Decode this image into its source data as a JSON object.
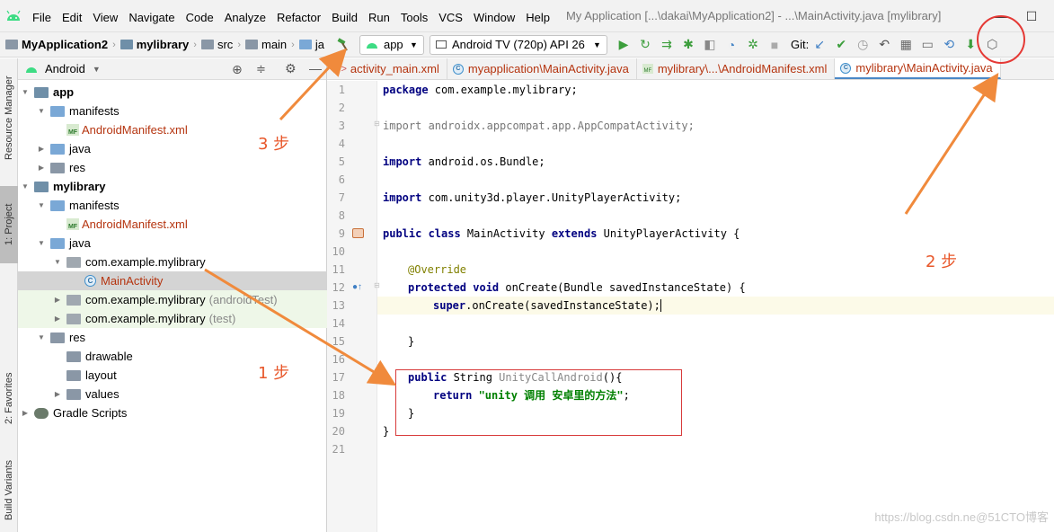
{
  "menubar": {
    "items": [
      "File",
      "Edit",
      "View",
      "Navigate",
      "Code",
      "Analyze",
      "Refactor",
      "Build",
      "Run",
      "Tools",
      "VCS",
      "Window",
      "Help"
    ],
    "window_title": "My Application [...\\dakai\\MyApplication2] - ...\\MainActivity.java [mylibrary]"
  },
  "toolbar": {
    "breadcrumbs": [
      "MyApplication2",
      "mylibrary",
      "src",
      "main",
      "ja"
    ],
    "run_config": "app",
    "device": "Android TV (720p) API 26",
    "git_label": "Git:"
  },
  "side_tabs": {
    "resource_manager": "Resource Manager",
    "project": "1: Project",
    "favorites": "2: Favorites",
    "build_variants": "Build Variants"
  },
  "project_panel": {
    "view_mode": "Android",
    "tree": [
      {
        "label": "app",
        "bold": true
      },
      {
        "label": "manifests"
      },
      {
        "label": "AndroidManifest.xml"
      },
      {
        "label": "java"
      },
      {
        "label": "res"
      },
      {
        "label": "mylibrary",
        "bold": true
      },
      {
        "label": "manifests"
      },
      {
        "label": "AndroidManifest.xml"
      },
      {
        "label": "java"
      },
      {
        "label": "com.example.mylibrary"
      },
      {
        "label": "MainActivity"
      },
      {
        "label": "com.example.mylibrary",
        "suffix": "(androidTest)"
      },
      {
        "label": "com.example.mylibrary",
        "suffix": "(test)"
      },
      {
        "label": "res"
      },
      {
        "label": "drawable"
      },
      {
        "label": "layout"
      },
      {
        "label": "values"
      },
      {
        "label": "Gradle Scripts"
      }
    ]
  },
  "editor": {
    "tabs": [
      "activity_main.xml",
      "myapplication\\MainActivity.java",
      "mylibrary\\...\\AndroidManifest.xml",
      "mylibrary\\MainActivity.java"
    ],
    "line_numbers": [
      "1",
      "2",
      "3",
      "4",
      "5",
      "6",
      "7",
      "8",
      "9",
      "10",
      "11",
      "12",
      "13",
      "14",
      "15",
      "16",
      "17",
      "18",
      "19",
      "20",
      "21"
    ]
  },
  "code": {
    "l1_kw": "package",
    "l1_rest": " com.example.mylibrary;",
    "l3_kw": "import",
    "l3_rest": " androidx.appcompat.app.AppCompatActivity;",
    "l5_kw": "import",
    "l5_rest": " android.os.Bundle;",
    "l7_kw": "import",
    "l7_rest": " com.unity3d.player.UnityPlayerActivity;",
    "l9_kw1": "public class",
    "l9_name": " MainActivity ",
    "l9_kw2": "extends",
    "l9_rest": " UnityPlayerActivity {",
    "l11_ann": "@Override",
    "l12_kw": "protected void",
    "l12_rest": " onCreate(Bundle savedInstanceState) {",
    "l13_kw": "super",
    "l13_rest": ".onCreate(savedInstanceState);",
    "l15": "}",
    "l17_kw": "public",
    "l17_type": " String ",
    "l17_fn": "UnityCallAndroid",
    "l17_rest": "(){",
    "l18_kw": "return",
    "l18_str": " \"unity 调用 安卓里的方法\"",
    "l18_rest": ";",
    "l19": "}",
    "l20": "}"
  },
  "annotations": {
    "step1": "1 步",
    "step2": "2 步",
    "step3": "3 步",
    "arrow_color": "#f08a3c",
    "highlight_color": "#d83a3a"
  },
  "watermark": "https://blog.csdn.ne@51CTO博客"
}
